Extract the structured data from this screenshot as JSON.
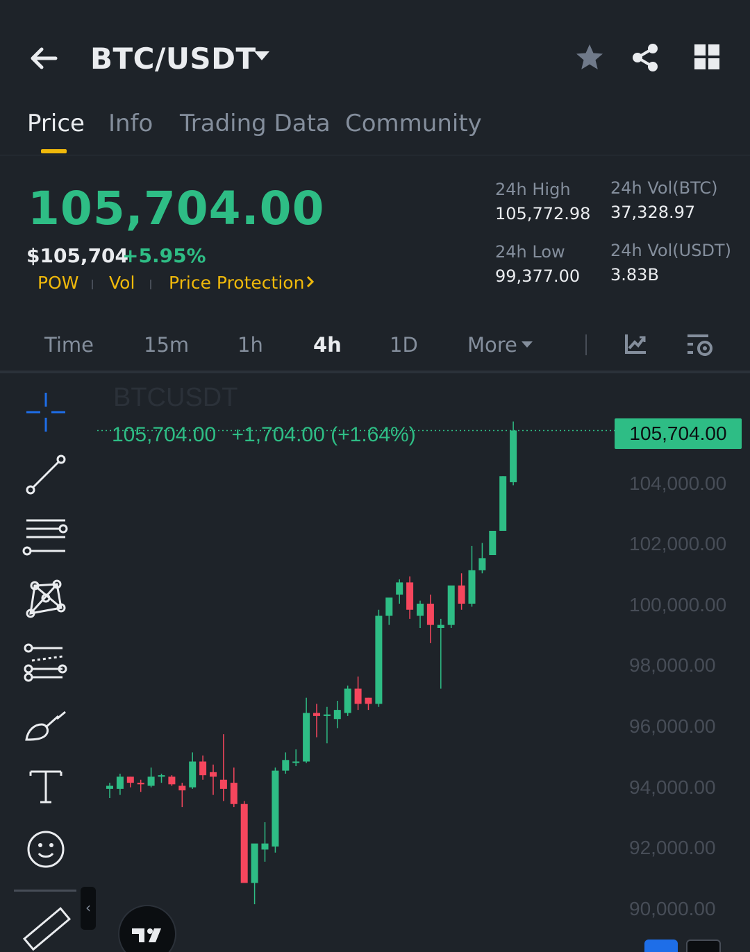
{
  "header": {
    "pair": "BTC/USDT",
    "icons": [
      "back-arrow-icon",
      "caret-down-icon",
      "star-icon",
      "share-icon",
      "grid-icon"
    ]
  },
  "tabs": [
    {
      "label": "Price",
      "active": true
    },
    {
      "label": "Info",
      "active": false
    },
    {
      "label": "Trading Data",
      "active": false
    },
    {
      "label": "Community",
      "active": false
    }
  ],
  "summary": {
    "last_price": "105,704.00",
    "usd_price": "$105,704",
    "change_pct": "+5.95%",
    "tags": [
      "POW",
      "Vol",
      "Price Protection"
    ],
    "high_label": "24h High",
    "high_value": "105,772.98",
    "low_label": "24h Low",
    "low_value": "99,377.00",
    "vol_btc_label": "24h Vol(BTC)",
    "vol_btc_value": "37,328.97",
    "vol_usdt_label": "24h Vol(USDT)",
    "vol_usdt_value": "3.83B"
  },
  "intervals": {
    "items": [
      "Time",
      "15m",
      "1h",
      "4h",
      "1D",
      "More"
    ],
    "active": "4h"
  },
  "chart": {
    "symbol": "BTCUSDT",
    "legend_price": "105,704.00",
    "legend_change": "+1,704.00 (+1.64%)",
    "last_price_tag": "105,704.00",
    "colors": {
      "up": "#2ebd85",
      "down": "#f6465d",
      "accent": "#f0b90b"
    }
  },
  "chart_data": {
    "type": "candlestick",
    "y_ticks": [
      "104,000.00",
      "102,000.00",
      "100,000.00",
      "98,000.00",
      "96,000.00",
      "94,000.00",
      "92,000.00",
      "90,000.00"
    ],
    "ylim": [
      89500,
      106400
    ],
    "candles": [
      {
        "o": 93900,
        "h": 94100,
        "l": 93600,
        "c": 94000
      },
      {
        "o": 93900,
        "h": 94400,
        "l": 93700,
        "c": 94300
      },
      {
        "o": 94300,
        "h": 94300,
        "l": 93950,
        "c": 94100
      },
      {
        "o": 94100,
        "h": 94200,
        "l": 93800,
        "c": 94050
      },
      {
        "o": 94000,
        "h": 94600,
        "l": 93950,
        "c": 94300
      },
      {
        "o": 94300,
        "h": 94400,
        "l": 94100,
        "c": 94350
      },
      {
        "o": 94300,
        "h": 94350,
        "l": 94000,
        "c": 94050
      },
      {
        "o": 94000,
        "h": 94100,
        "l": 93300,
        "c": 93850
      },
      {
        "o": 93950,
        "h": 95100,
        "l": 93900,
        "c": 94800
      },
      {
        "o": 94800,
        "h": 95000,
        "l": 94200,
        "c": 94350
      },
      {
        "o": 94450,
        "h": 94700,
        "l": 93700,
        "c": 94300
      },
      {
        "o": 94200,
        "h": 95700,
        "l": 93500,
        "c": 93900
      },
      {
        "o": 94100,
        "h": 94600,
        "l": 93300,
        "c": 93400
      },
      {
        "o": 93400,
        "h": 93500,
        "l": 91200,
        "c": 90800
      },
      {
        "o": 90800,
        "h": 91500,
        "l": 90100,
        "c": 92100
      },
      {
        "o": 91900,
        "h": 92800,
        "l": 91500,
        "c": 92100
      },
      {
        "o": 92000,
        "h": 94600,
        "l": 91800,
        "c": 94500
      },
      {
        "o": 94500,
        "h": 95100,
        "l": 94400,
        "c": 94850
      },
      {
        "o": 94800,
        "h": 95200,
        "l": 94650,
        "c": 94800
      },
      {
        "o": 94800,
        "h": 96900,
        "l": 94750,
        "c": 96400
      },
      {
        "o": 96400,
        "h": 96700,
        "l": 95600,
        "c": 96300
      },
      {
        "o": 96300,
        "h": 96600,
        "l": 95400,
        "c": 96350
      },
      {
        "o": 96200,
        "h": 96800,
        "l": 95900,
        "c": 96500
      },
      {
        "o": 96400,
        "h": 97300,
        "l": 96300,
        "c": 97200
      },
      {
        "o": 97200,
        "h": 97600,
        "l": 96500,
        "c": 96700
      },
      {
        "o": 96900,
        "h": 96900,
        "l": 96500,
        "c": 96700
      },
      {
        "o": 96700,
        "h": 99800,
        "l": 96600,
        "c": 99600
      },
      {
        "o": 99600,
        "h": 100000,
        "l": 99300,
        "c": 100200
      },
      {
        "o": 100300,
        "h": 100800,
        "l": 100000,
        "c": 100700
      },
      {
        "o": 100700,
        "h": 100900,
        "l": 99500,
        "c": 99800
      },
      {
        "o": 99600,
        "h": 100100,
        "l": 99200,
        "c": 100000
      },
      {
        "o": 100000,
        "h": 100300,
        "l": 98700,
        "c": 99300
      },
      {
        "o": 99200,
        "h": 99500,
        "l": 97200,
        "c": 99300
      },
      {
        "o": 99300,
        "h": 100400,
        "l": 99200,
        "c": 100600
      },
      {
        "o": 100600,
        "h": 101000,
        "l": 99800,
        "c": 100000
      },
      {
        "o": 100000,
        "h": 101900,
        "l": 99900,
        "c": 101100
      },
      {
        "o": 101100,
        "h": 102000,
        "l": 101000,
        "c": 101500
      },
      {
        "o": 101600,
        "h": 102400,
        "l": 101600,
        "c": 102400
      },
      {
        "o": 102400,
        "h": 104200,
        "l": 102400,
        "c": 104200
      },
      {
        "o": 104000,
        "h": 106000,
        "l": 103900,
        "c": 105704
      }
    ]
  }
}
